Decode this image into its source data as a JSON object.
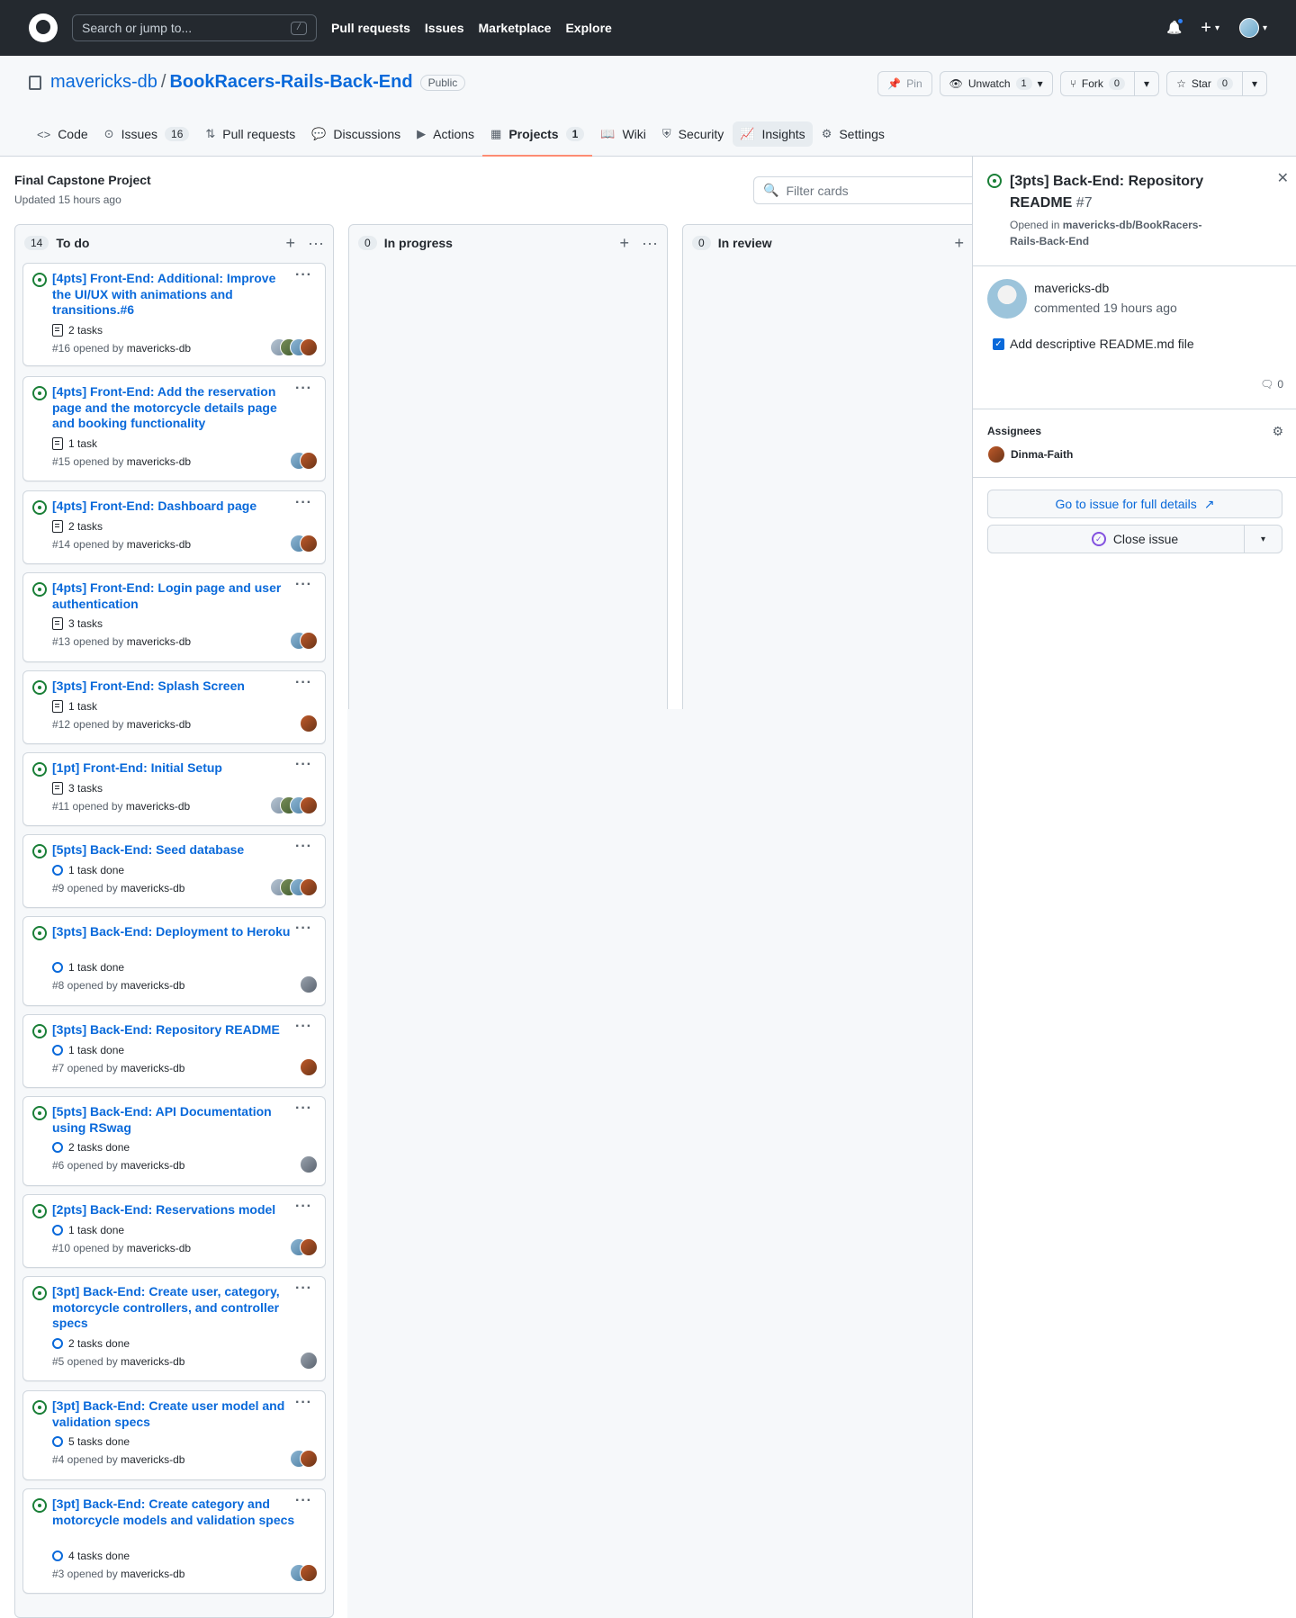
{
  "header": {
    "search_placeholder": "Search or jump to...",
    "search_kbd": "/",
    "nav": [
      "Pull requests",
      "Issues",
      "Marketplace",
      "Explore"
    ]
  },
  "repo": {
    "owner": "mavericks-db",
    "separator": "/",
    "name": "BookRacers-Rails-Back-End",
    "visibility": "Public",
    "pin_label": "Pin",
    "unwatch_label": "Unwatch",
    "unwatch_count": "1",
    "fork_label": "Fork",
    "fork_count": "0",
    "star_label": "Star",
    "star_count": "0"
  },
  "tabs": [
    {
      "label": "Code",
      "icon": "code-icon",
      "count": ""
    },
    {
      "label": "Issues",
      "icon": "issue-icon",
      "count": "16"
    },
    {
      "label": "Pull requests",
      "icon": "pull-request-icon",
      "count": ""
    },
    {
      "label": "Discussions",
      "icon": "discussions-icon",
      "count": ""
    },
    {
      "label": "Actions",
      "icon": "play-icon",
      "count": ""
    },
    {
      "label": "Projects",
      "icon": "project-icon",
      "count": "1"
    },
    {
      "label": "Wiki",
      "icon": "book-icon",
      "count": ""
    },
    {
      "label": "Security",
      "icon": "shield-icon",
      "count": ""
    },
    {
      "label": "Insights",
      "icon": "graph-icon",
      "count": ""
    },
    {
      "label": "Settings",
      "icon": "gear-icon",
      "count": ""
    }
  ],
  "project": {
    "title": "Final Capstone Project",
    "updated": "Updated 15 hours ago",
    "filter_placeholder": "Filter cards"
  },
  "columns": [
    {
      "count": "14",
      "name": "To do"
    },
    {
      "count": "0",
      "name": "In progress"
    },
    {
      "count": "0",
      "name": "In review"
    }
  ],
  "cards": [
    {
      "title": "[4pts] Front-End: Additional: Improve the UI/UX with animations and transitions.#6",
      "tasks": "2 tasks",
      "tasks_type": "list",
      "meta_prefix": "#16 opened by ",
      "author": "mavericks-db",
      "avatars": 4
    },
    {
      "title": "[4pts] Front-End: Add the reservation page and the motorcycle details page and booking functionality",
      "tasks": "1 task",
      "tasks_type": "list",
      "meta_prefix": "#15 opened by ",
      "author": "mavericks-db",
      "avatars": 2
    },
    {
      "title": "[4pts] Front-End: Dashboard page",
      "tasks": "2 tasks",
      "tasks_type": "list",
      "meta_prefix": "#14 opened by ",
      "author": "mavericks-db",
      "avatars": 2
    },
    {
      "title": "[4pts] Front-End: Login page and user authentication",
      "tasks": "3 tasks",
      "tasks_type": "list",
      "meta_prefix": "#13 opened by ",
      "author": "mavericks-db",
      "avatars": 2
    },
    {
      "title": "[3pts] Front-End: Splash Screen",
      "tasks": "1 task",
      "tasks_type": "list",
      "meta_prefix": "#12 opened by ",
      "author": "mavericks-db",
      "avatars": 1
    },
    {
      "title": "[1pt] Front-End: Initial Setup",
      "tasks": "3 tasks",
      "tasks_type": "list",
      "meta_prefix": "#11 opened by ",
      "author": "mavericks-db",
      "avatars": 4
    },
    {
      "title": "[5pts] Back-End: Seed database",
      "tasks": "1 task done",
      "tasks_type": "progress",
      "meta_prefix": "#9 opened by ",
      "author": "mavericks-db",
      "avatars": 4
    },
    {
      "title": "[3pts] Back-End: Deployment to Heroku",
      "tasks": "1 task done",
      "tasks_type": "progress",
      "meta_prefix": "#8 opened by ",
      "author": "mavericks-db",
      "avatars": 1
    },
    {
      "title": "[3pts] Back-End: Repository README",
      "tasks": "1 task done",
      "tasks_type": "progress",
      "meta_prefix": "#7 opened by ",
      "author": "mavericks-db",
      "avatars": 1
    },
    {
      "title": "[5pts] Back-End: API Documentation using RSwag",
      "tasks": "2 tasks done",
      "tasks_type": "progress",
      "meta_prefix": "#6 opened by ",
      "author": "mavericks-db",
      "avatars": 1
    },
    {
      "title": "[2pts] Back-End: Reservations model",
      "tasks": "1 task done",
      "tasks_type": "progress",
      "meta_prefix": "#10 opened by ",
      "author": "mavericks-db",
      "avatars": 2
    },
    {
      "title": "[3pt] Back-End: Create user, category, motorcycle controllers, and controller specs",
      "tasks": "2 tasks done",
      "tasks_type": "progress",
      "meta_prefix": "#5 opened by ",
      "author": "mavericks-db",
      "avatars": 1
    },
    {
      "title": "[3pt] Back-End: Create user model and validation specs",
      "tasks": "5 tasks done",
      "tasks_type": "progress",
      "meta_prefix": "#4 opened by ",
      "author": "mavericks-db",
      "avatars": 2
    },
    {
      "title": "[3pt] Back-End: Create category and motorcycle models and validation specs",
      "tasks": "4 tasks done",
      "tasks_type": "progress",
      "meta_prefix": "#3 opened by ",
      "author": "mavericks-db",
      "avatars": 2
    }
  ],
  "side": {
    "title": "[3pts] Back-End: Repository README",
    "number": "#7",
    "opened_prefix": "Opened in ",
    "opened_repo": "mavericks-db/BookRacers-Rails-Back-End",
    "author": "mavericks-db",
    "commented": "commented 19 hours ago",
    "checkbox_label": "Add descriptive README.md file",
    "comment_count": "0",
    "assignees_label": "Assignees",
    "assignee": "Dinma-Faith",
    "go_to_issue": "Go to issue for full details",
    "close_issue": "Close issue"
  }
}
